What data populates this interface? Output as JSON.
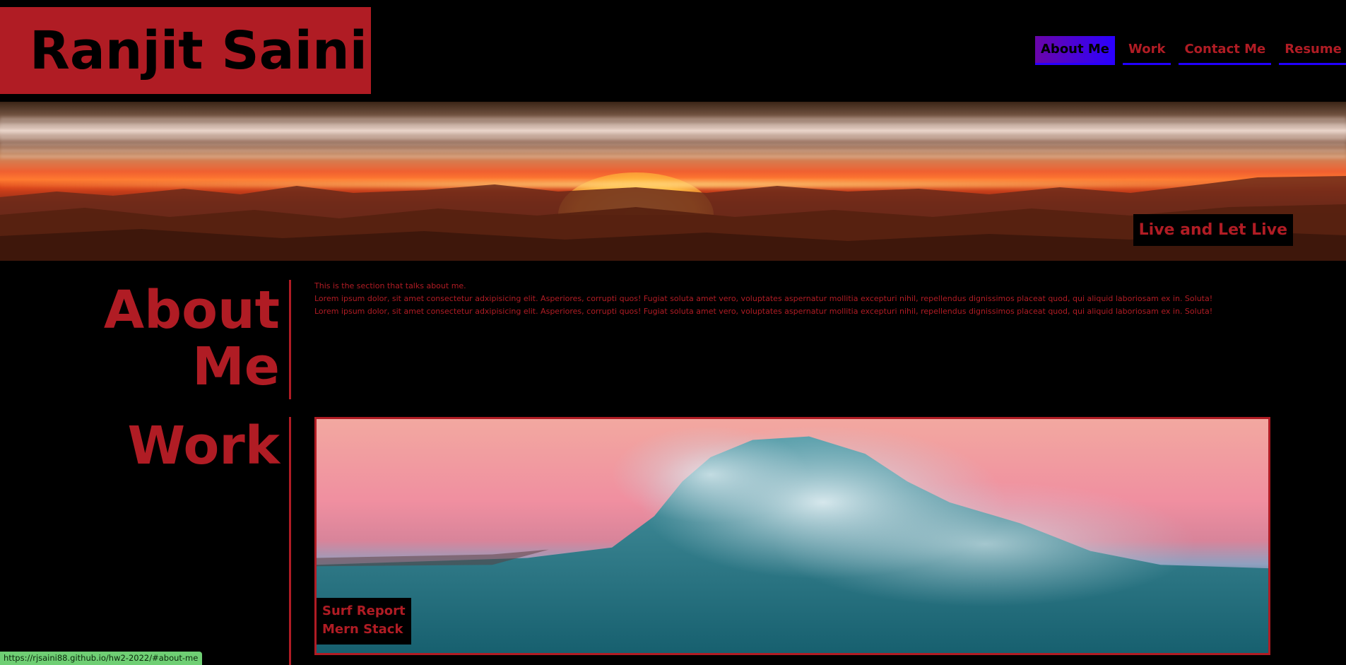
{
  "header": {
    "brand_name": "Ranjit Saini",
    "nav": [
      {
        "label": "About Me",
        "active": true
      },
      {
        "label": "Work",
        "active": false
      },
      {
        "label": "Contact Me",
        "active": false
      },
      {
        "label": "Resume",
        "active": false
      }
    ]
  },
  "hero": {
    "tagline": "Live and Let Live"
  },
  "about": {
    "title_line1": "About",
    "title_line2": "Me",
    "paragraphs": [
      "This is the section that talks about me.",
      "Lorem ipsum dolor, sit amet consectetur adxipisicing elit. Asperiores, corrupti quos! Fugiat soluta amet vero, voluptates aspernatur mollitia excepturi nihil, repellendus dignissimos placeat quod, qui aliquid laboriosam ex in. Soluta!",
      "Lorem ipsum dolor, sit amet consectetur adxipisicing elit. Asperiores, corrupti quos! Fugiat soluta amet vero, voluptates aspernatur mollitia excepturi nihil, repellendus dignissimos placeat quod, qui aliquid laboriosam ex in. Soluta!"
    ]
  },
  "work": {
    "title": "Work",
    "card": {
      "line1": "Surf Report",
      "line2": "Mern Stack"
    }
  },
  "status_bar": {
    "url": "https://rjsaini88.github.io/hw2-2022/#about-me"
  },
  "colors": {
    "accent": "#b01c24",
    "background": "#000000",
    "nav_active_start": "#6a05a8",
    "nav_active_end": "#2a00ff",
    "status_bar": "#6fcf74"
  }
}
